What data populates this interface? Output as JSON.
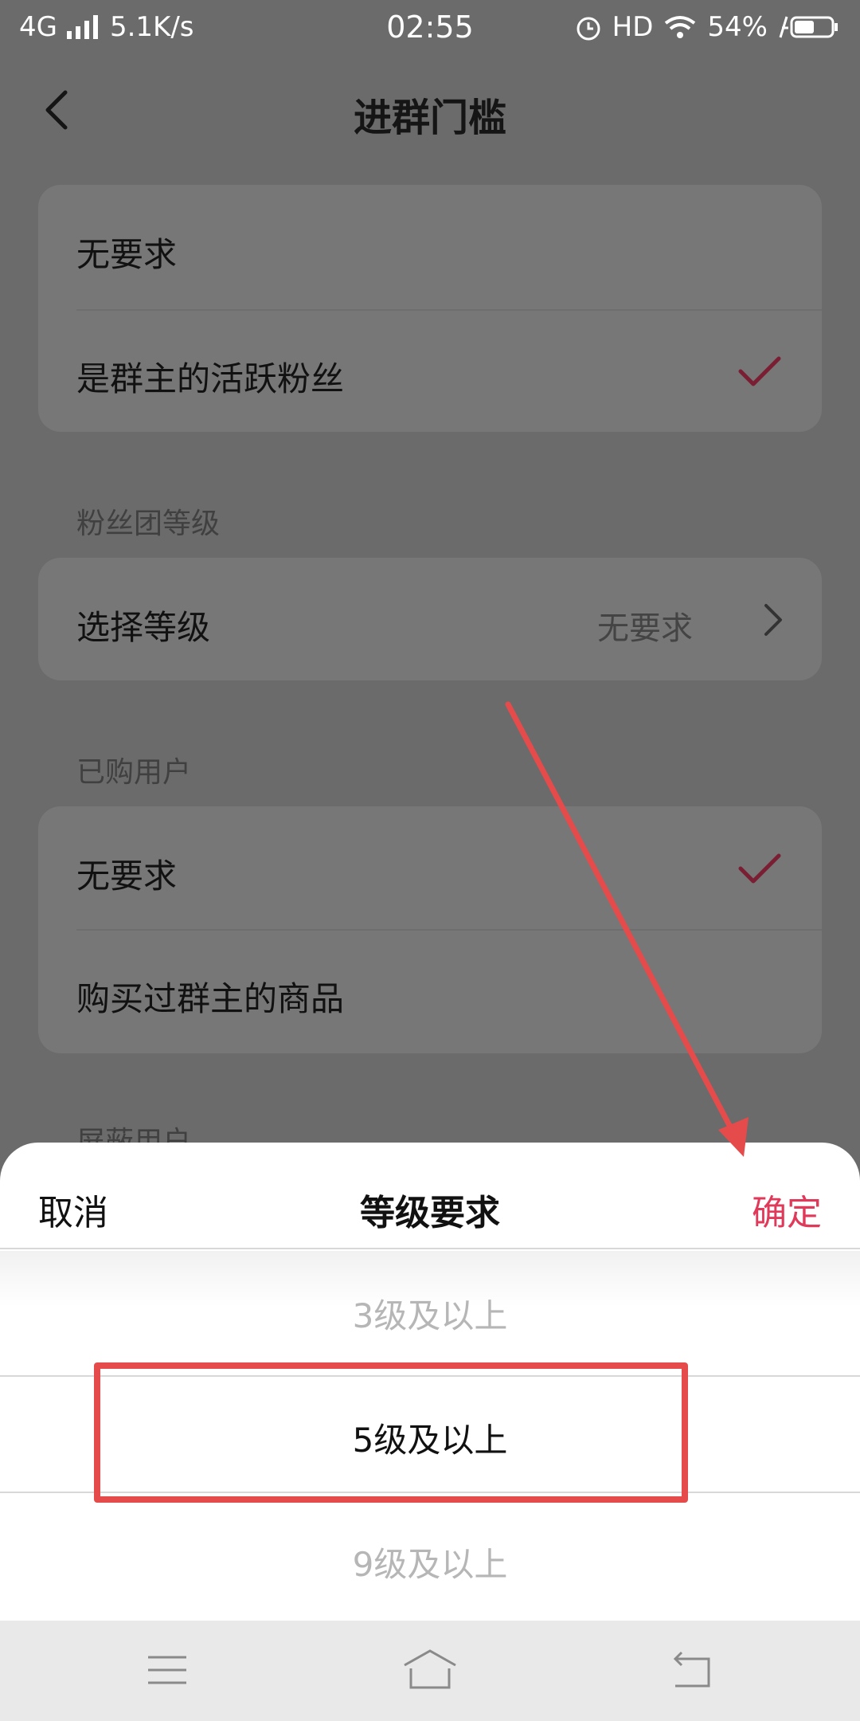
{
  "status": {
    "network": "4G",
    "speed": "5.1K/s",
    "time": "02:55",
    "hd": "HD",
    "battery": "54%"
  },
  "header": {
    "title": "进群门槛"
  },
  "group1": {
    "option1": "无要求",
    "option2": "是群主的活跃粉丝"
  },
  "fan_section": {
    "label": "粉丝团等级",
    "row_label": "选择等级",
    "row_value": "无要求"
  },
  "bought_section": {
    "label": "已购用户",
    "option1": "无要求",
    "option2": "购买过群主的商品"
  },
  "partial_section_label": "屏蔽用户",
  "sheet": {
    "cancel": "取消",
    "title": "等级要求",
    "confirm": "确定",
    "options": [
      "3级及以上",
      "5级及以上",
      "9级及以上"
    ]
  },
  "colors": {
    "accent": "#e03a5b",
    "check": "#7a1f33",
    "annotation": "#e64b4b"
  },
  "icons": [
    "back-icon",
    "check-icon",
    "chevron-right-icon",
    "menu-icon",
    "home-icon",
    "return-icon"
  ]
}
